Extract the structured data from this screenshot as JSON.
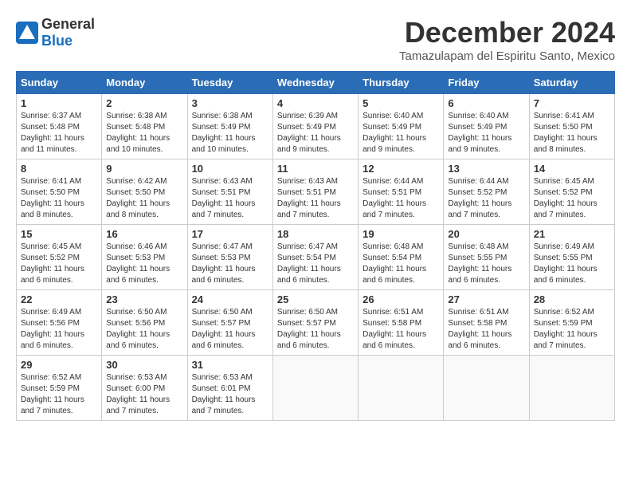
{
  "logo": {
    "general": "General",
    "blue": "Blue"
  },
  "title": "December 2024",
  "location": "Tamazulapam del Espiritu Santo, Mexico",
  "days_of_week": [
    "Sunday",
    "Monday",
    "Tuesday",
    "Wednesday",
    "Thursday",
    "Friday",
    "Saturday"
  ],
  "weeks": [
    [
      {
        "day": "1",
        "sunrise": "Sunrise: 6:37 AM",
        "sunset": "Sunset: 5:48 PM",
        "daylight": "Daylight: 11 hours and 11 minutes."
      },
      {
        "day": "2",
        "sunrise": "Sunrise: 6:38 AM",
        "sunset": "Sunset: 5:48 PM",
        "daylight": "Daylight: 11 hours and 10 minutes."
      },
      {
        "day": "3",
        "sunrise": "Sunrise: 6:38 AM",
        "sunset": "Sunset: 5:49 PM",
        "daylight": "Daylight: 11 hours and 10 minutes."
      },
      {
        "day": "4",
        "sunrise": "Sunrise: 6:39 AM",
        "sunset": "Sunset: 5:49 PM",
        "daylight": "Daylight: 11 hours and 9 minutes."
      },
      {
        "day": "5",
        "sunrise": "Sunrise: 6:40 AM",
        "sunset": "Sunset: 5:49 PM",
        "daylight": "Daylight: 11 hours and 9 minutes."
      },
      {
        "day": "6",
        "sunrise": "Sunrise: 6:40 AM",
        "sunset": "Sunset: 5:49 PM",
        "daylight": "Daylight: 11 hours and 9 minutes."
      },
      {
        "day": "7",
        "sunrise": "Sunrise: 6:41 AM",
        "sunset": "Sunset: 5:50 PM",
        "daylight": "Daylight: 11 hours and 8 minutes."
      }
    ],
    [
      {
        "day": "8",
        "sunrise": "Sunrise: 6:41 AM",
        "sunset": "Sunset: 5:50 PM",
        "daylight": "Daylight: 11 hours and 8 minutes."
      },
      {
        "day": "9",
        "sunrise": "Sunrise: 6:42 AM",
        "sunset": "Sunset: 5:50 PM",
        "daylight": "Daylight: 11 hours and 8 minutes."
      },
      {
        "day": "10",
        "sunrise": "Sunrise: 6:43 AM",
        "sunset": "Sunset: 5:51 PM",
        "daylight": "Daylight: 11 hours and 7 minutes."
      },
      {
        "day": "11",
        "sunrise": "Sunrise: 6:43 AM",
        "sunset": "Sunset: 5:51 PM",
        "daylight": "Daylight: 11 hours and 7 minutes."
      },
      {
        "day": "12",
        "sunrise": "Sunrise: 6:44 AM",
        "sunset": "Sunset: 5:51 PM",
        "daylight": "Daylight: 11 hours and 7 minutes."
      },
      {
        "day": "13",
        "sunrise": "Sunrise: 6:44 AM",
        "sunset": "Sunset: 5:52 PM",
        "daylight": "Daylight: 11 hours and 7 minutes."
      },
      {
        "day": "14",
        "sunrise": "Sunrise: 6:45 AM",
        "sunset": "Sunset: 5:52 PM",
        "daylight": "Daylight: 11 hours and 7 minutes."
      }
    ],
    [
      {
        "day": "15",
        "sunrise": "Sunrise: 6:45 AM",
        "sunset": "Sunset: 5:52 PM",
        "daylight": "Daylight: 11 hours and 6 minutes."
      },
      {
        "day": "16",
        "sunrise": "Sunrise: 6:46 AM",
        "sunset": "Sunset: 5:53 PM",
        "daylight": "Daylight: 11 hours and 6 minutes."
      },
      {
        "day": "17",
        "sunrise": "Sunrise: 6:47 AM",
        "sunset": "Sunset: 5:53 PM",
        "daylight": "Daylight: 11 hours and 6 minutes."
      },
      {
        "day": "18",
        "sunrise": "Sunrise: 6:47 AM",
        "sunset": "Sunset: 5:54 PM",
        "daylight": "Daylight: 11 hours and 6 minutes."
      },
      {
        "day": "19",
        "sunrise": "Sunrise: 6:48 AM",
        "sunset": "Sunset: 5:54 PM",
        "daylight": "Daylight: 11 hours and 6 minutes."
      },
      {
        "day": "20",
        "sunrise": "Sunrise: 6:48 AM",
        "sunset": "Sunset: 5:55 PM",
        "daylight": "Daylight: 11 hours and 6 minutes."
      },
      {
        "day": "21",
        "sunrise": "Sunrise: 6:49 AM",
        "sunset": "Sunset: 5:55 PM",
        "daylight": "Daylight: 11 hours and 6 minutes."
      }
    ],
    [
      {
        "day": "22",
        "sunrise": "Sunrise: 6:49 AM",
        "sunset": "Sunset: 5:56 PM",
        "daylight": "Daylight: 11 hours and 6 minutes."
      },
      {
        "day": "23",
        "sunrise": "Sunrise: 6:50 AM",
        "sunset": "Sunset: 5:56 PM",
        "daylight": "Daylight: 11 hours and 6 minutes."
      },
      {
        "day": "24",
        "sunrise": "Sunrise: 6:50 AM",
        "sunset": "Sunset: 5:57 PM",
        "daylight": "Daylight: 11 hours and 6 minutes."
      },
      {
        "day": "25",
        "sunrise": "Sunrise: 6:50 AM",
        "sunset": "Sunset: 5:57 PM",
        "daylight": "Daylight: 11 hours and 6 minutes."
      },
      {
        "day": "26",
        "sunrise": "Sunrise: 6:51 AM",
        "sunset": "Sunset: 5:58 PM",
        "daylight": "Daylight: 11 hours and 6 minutes."
      },
      {
        "day": "27",
        "sunrise": "Sunrise: 6:51 AM",
        "sunset": "Sunset: 5:58 PM",
        "daylight": "Daylight: 11 hours and 6 minutes."
      },
      {
        "day": "28",
        "sunrise": "Sunrise: 6:52 AM",
        "sunset": "Sunset: 5:59 PM",
        "daylight": "Daylight: 11 hours and 7 minutes."
      }
    ],
    [
      {
        "day": "29",
        "sunrise": "Sunrise: 6:52 AM",
        "sunset": "Sunset: 5:59 PM",
        "daylight": "Daylight: 11 hours and 7 minutes."
      },
      {
        "day": "30",
        "sunrise": "Sunrise: 6:53 AM",
        "sunset": "Sunset: 6:00 PM",
        "daylight": "Daylight: 11 hours and 7 minutes."
      },
      {
        "day": "31",
        "sunrise": "Sunrise: 6:53 AM",
        "sunset": "Sunset: 6:01 PM",
        "daylight": "Daylight: 11 hours and 7 minutes."
      },
      null,
      null,
      null,
      null
    ]
  ]
}
